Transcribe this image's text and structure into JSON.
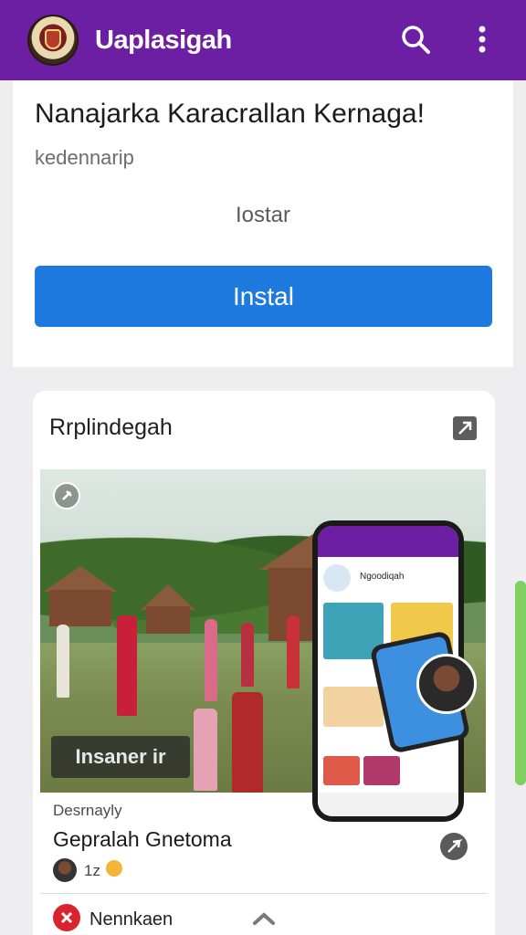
{
  "app": {
    "title": "Uaplasigah"
  },
  "install_card": {
    "title": "Nanajarka Karacrallan Kernaga!",
    "subtitle": "kedennarip",
    "mid_label": "Iostar",
    "button_label": "Instal"
  },
  "feed": {
    "section_title": "Rrplindegah",
    "photo_label": "Insaner ir",
    "phone_title": "Ngoodiqah",
    "kind": "Desrnayly",
    "post_title": "Gepralah Gnetoma",
    "reactions": "1z",
    "footer_label": "Nennkaen"
  },
  "colors": {
    "appbar": "#6c1fa3",
    "install_button": "#1f7ae0",
    "scroll_indicator": "#7fcf63",
    "footer_icon": "#d9232e"
  },
  "icons": [
    "crest-logo",
    "search-icon",
    "more-vert-icon",
    "share-icon",
    "pin-icon",
    "send-icon",
    "chevron-up-icon"
  ]
}
